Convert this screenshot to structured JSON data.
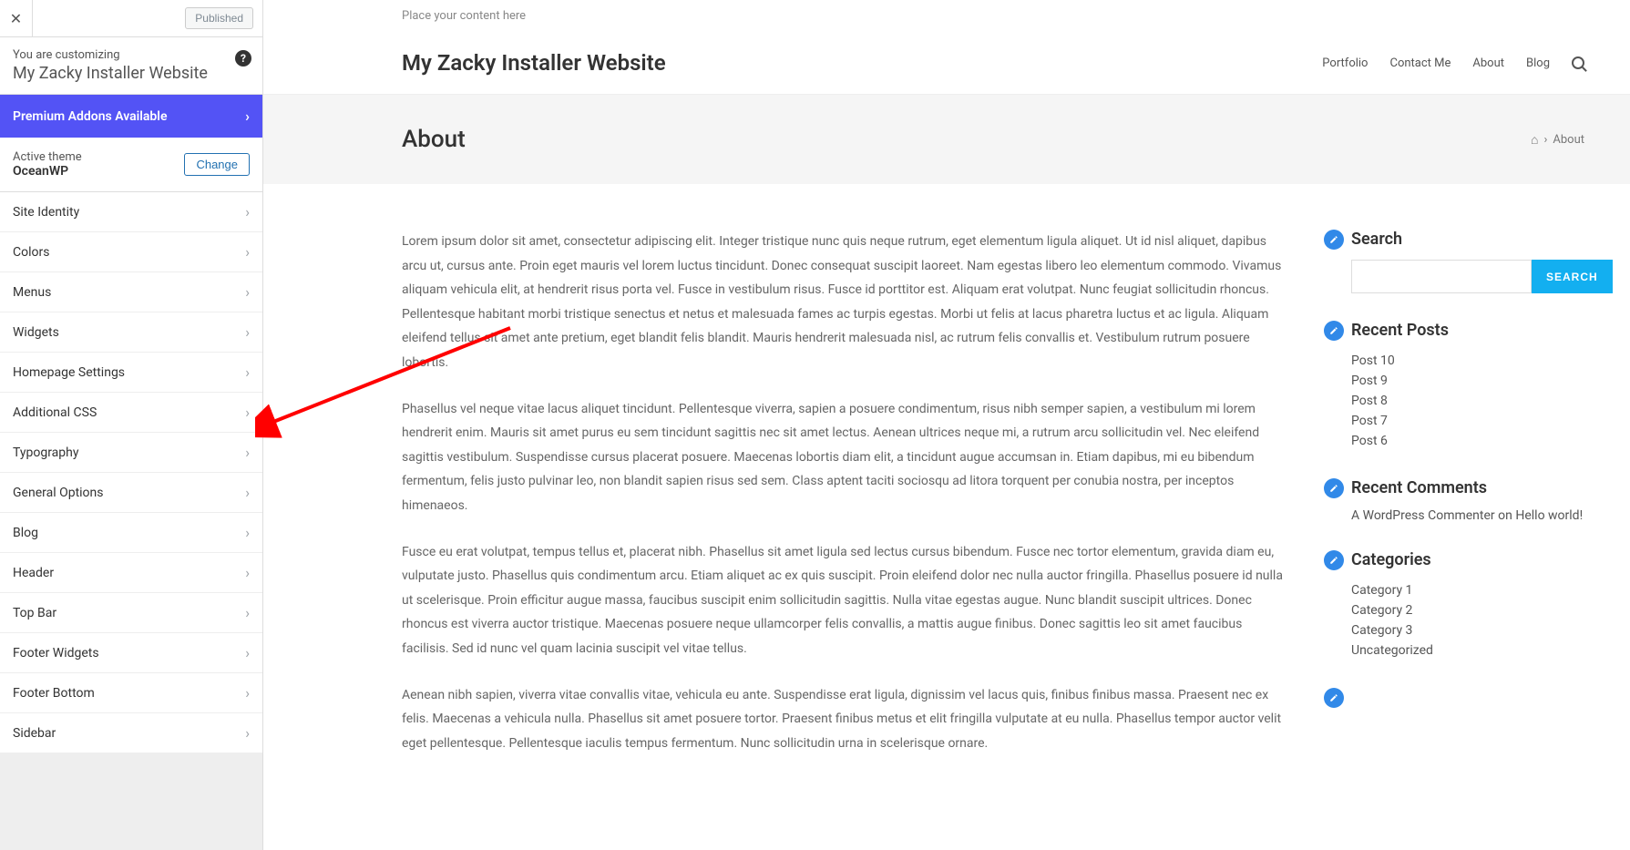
{
  "sidebar": {
    "published_label": "Published",
    "customizing_label": "You are customizing",
    "customizing_title": "My Zacky Installer Website",
    "premium_label": "Premium Addons Available",
    "active_theme_label": "Active theme",
    "theme_name": "OceanWP",
    "change_label": "Change",
    "menu_items": [
      "Site Identity",
      "Colors",
      "Menus",
      "Widgets",
      "Homepage Settings",
      "Additional CSS",
      "Typography",
      "General Options",
      "Blog",
      "Header",
      "Top Bar",
      "Footer Widgets",
      "Footer Bottom",
      "Sidebar"
    ]
  },
  "preview": {
    "placeholder": "Place your content here",
    "site_title": "My Zacky Installer Website",
    "nav": [
      "Portfolio",
      "Contact Me",
      "About",
      "Blog"
    ],
    "page_title": "About",
    "breadcrumb_current": "About",
    "paragraphs": [
      "Lorem ipsum dolor sit amet, consectetur adipiscing elit. Integer tristique nunc quis neque rutrum, eget elementum ligula aliquet. Ut id nisl aliquet, dapibus arcu ut, cursus ante. Proin eget mauris vel lorem luctus tincidunt. Donec consequat suscipit laoreet. Nam egestas libero leo elementum commodo. Vivamus aliquam vehicula elit, at hendrerit risus porta vel. Fusce in vestibulum risus. Fusce id porttitor est. Aliquam erat volutpat. Nunc feugiat sollicitudin rhoncus. Pellentesque habitant morbi tristique senectus et netus et malesuada fames ac turpis egestas. Morbi ut felis at lacus pharetra luctus et ac ligula. Aliquam eleifend tellus sit amet ante pretium, eget blandit felis blandit. Mauris hendrerit malesuada nisl, ac rutrum felis convallis et. Vestibulum rutrum posuere lobortis.",
      "Phasellus vel neque vitae lacus aliquet tincidunt. Pellentesque viverra, sapien a posuere condimentum, risus nibh semper sapien, a vestibulum mi lorem hendrerit enim. Mauris sit amet purus eu sem tincidunt sagittis nec sit amet lectus. Aenean ultrices neque mi, a rutrum arcu sollicitudin vel. Nec eleifend sagittis vestibulum. Suspendisse cursus placerat posuere. Maecenas lobortis diam elit, a tincidunt augue accumsan in. Etiam dapibus, mi eu bibendum fermentum, felis justo pulvinar leo, non blandit sapien risus sed sem. Class aptent taciti sociosqu ad litora torquent per conubia nostra, per inceptos himenaeos.",
      "Fusce eu erat volutpat, tempus tellus et, placerat nibh. Phasellus sit amet ligula sed lectus cursus bibendum. Fusce nec tortor elementum, gravida diam eu, vulputate justo. Phasellus quis condimentum arcu. Etiam aliquet ac ex quis suscipit. Proin eleifend dolor nec nulla auctor fringilla. Phasellus posuere id nulla ut scelerisque. Proin efficitur augue massa, faucibus suscipit enim sollicitudin sagittis. Nulla vitae egestas augue. Nunc blandit suscipit ultrices. Donec rhoncus est viverra auctor tristique. Maecenas posuere neque ullamcorper felis convallis, a mattis augue finibus. Donec sagittis leo sit amet faucibus facilisis. Sed id nunc vel quam lacinia suscipit vel vitae tellus.",
      "Aenean nibh sapien, viverra vitae convallis vitae, vehicula eu ante. Suspendisse erat ligula, dignissim vel lacus quis, finibus finibus massa. Praesent nec ex felis. Maecenas a vehicula nulla. Phasellus sit amet posuere tortor. Praesent finibus metus et elit fringilla vulputate at eu nulla. Phasellus tempor auctor velit eget pellentesque. Pellentesque iaculis tempus fermentum. Nunc sollicitudin urna in scelerisque ornare."
    ],
    "widgets": {
      "search_title": "Search",
      "search_button": "SEARCH",
      "recent_posts_title": "Recent Posts",
      "recent_posts": [
        "Post 10",
        "Post 9",
        "Post 8",
        "Post 7",
        "Post 6"
      ],
      "recent_comments_title": "Recent Comments",
      "comment_author": "A WordPress Commenter",
      "comment_on": " on ",
      "comment_post": "Hello world!",
      "categories_title": "Categories",
      "categories": [
        "Category 1",
        "Category 2",
        "Category 3",
        "Uncategorized"
      ]
    }
  }
}
